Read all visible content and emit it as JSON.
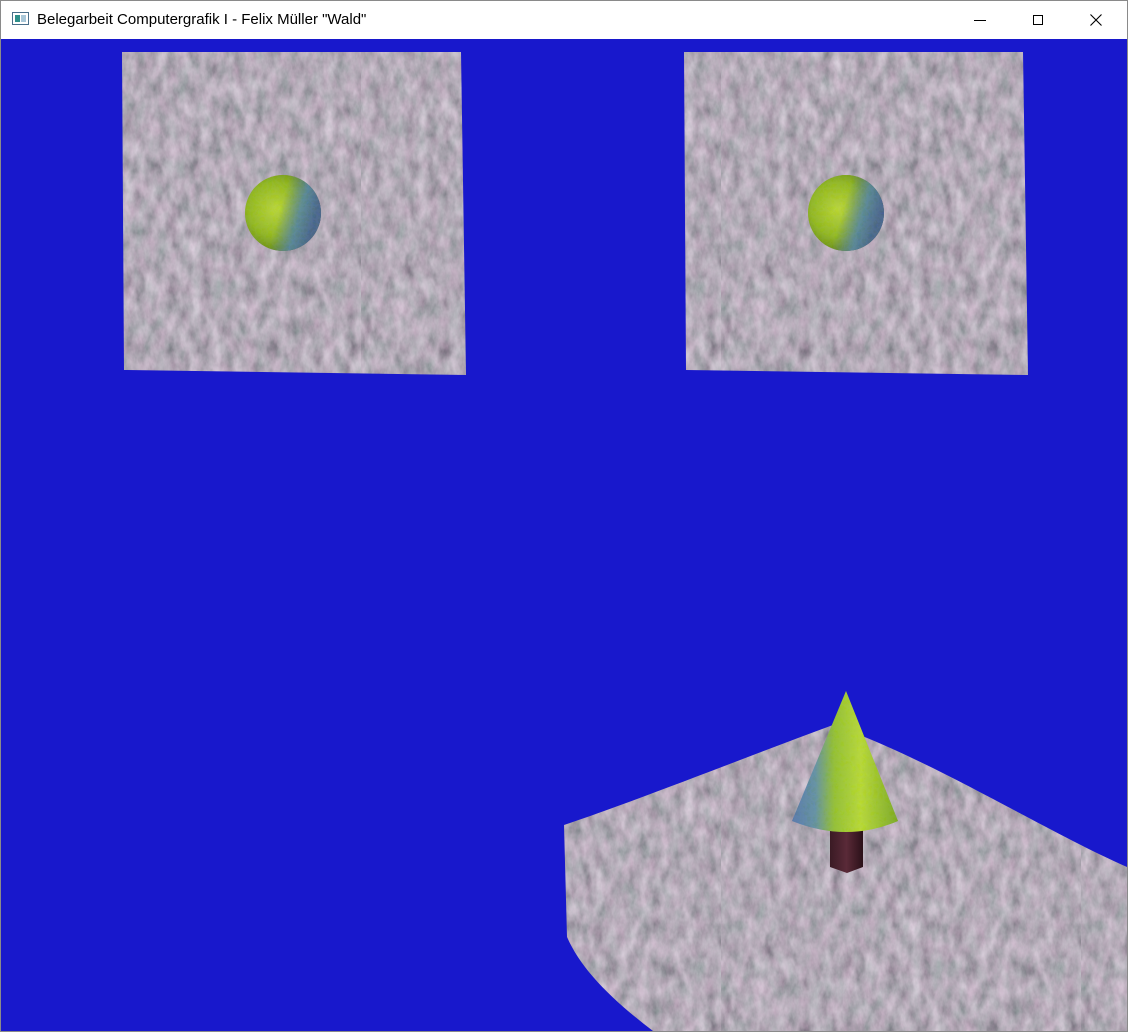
{
  "window": {
    "title": "Belegarbeit Computergrafik I - Felix Müller \"Wald\"",
    "icon": "app-window-icon",
    "controls": {
      "minimize": "minimize-icon",
      "maximize": "maximize-icon",
      "close": "close-icon"
    }
  },
  "scene": {
    "background_color": "#1818CC",
    "ground_color": "#5A4A58",
    "foliage_colors": [
      "#A8C832",
      "#4A7A20",
      "#3A5AD8"
    ],
    "trunk_color": "#4A2430"
  }
}
